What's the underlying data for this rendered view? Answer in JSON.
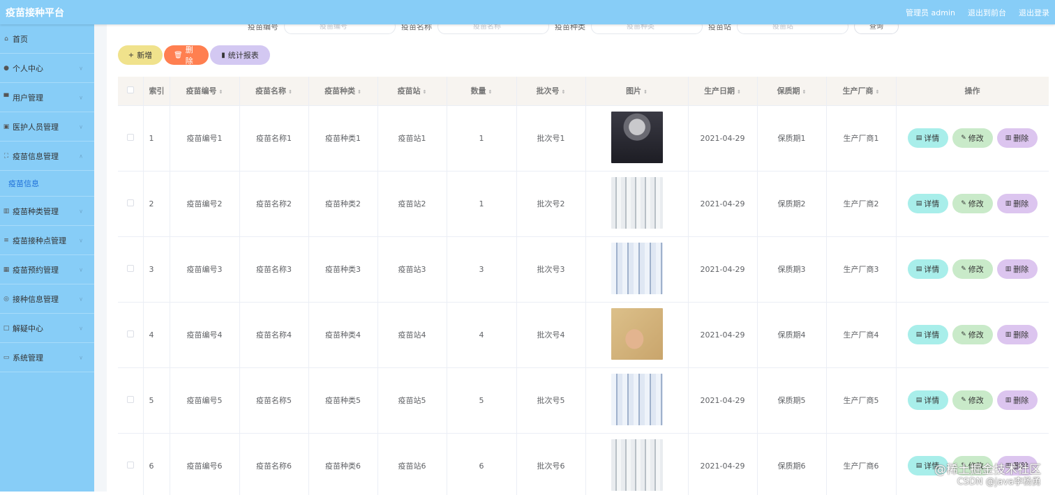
{
  "header": {
    "brand": "疫苗接种平台",
    "links": [
      "管理员 admin",
      "退出到前台",
      "退出登录"
    ]
  },
  "sidebar": {
    "items": [
      {
        "label": "首页",
        "icon": "home-icon",
        "chevron": false
      },
      {
        "label": "个人中心",
        "icon": "user-icon",
        "chevron": true
      },
      {
        "label": "用户管理",
        "icon": "users-icon",
        "chevron": true
      },
      {
        "label": "医护人员管理",
        "icon": "medical-icon",
        "chevron": true
      },
      {
        "label": "疫苗信息管理",
        "icon": "expand-icon",
        "chevron": true,
        "expanded": true
      }
    ],
    "submenu_label": "疫苗信息",
    "items2": [
      {
        "label": "疫苗种类管理",
        "icon": "bar-chart-icon"
      },
      {
        "label": "疫苗接种点管理",
        "icon": "list-icon"
      },
      {
        "label": "疫苗预约管理",
        "icon": "calendar-icon"
      },
      {
        "label": "接种信息管理",
        "icon": "globe-icon"
      },
      {
        "label": "解疑中心",
        "icon": "chat-icon"
      },
      {
        "label": "系统管理",
        "icon": "monitor-icon"
      }
    ]
  },
  "search": {
    "fields": [
      {
        "label": "疫苗编号",
        "placeholder": "疫苗编号"
      },
      {
        "label": "疫苗名称",
        "placeholder": "疫苗名称"
      },
      {
        "label": "疫苗种类",
        "placeholder": "疫苗种类"
      },
      {
        "label": "疫苗站",
        "placeholder": "疫苗站"
      }
    ],
    "query_label": "查询"
  },
  "toolbar": {
    "add_label": "新增",
    "delete_label": "删除",
    "report_label": "统计报表"
  },
  "table": {
    "columns": [
      "索引",
      "疫苗编号",
      "疫苗名称",
      "疫苗种类",
      "疫苗站",
      "数量",
      "批次号",
      "图片",
      "生产日期",
      "保质期",
      "生产厂商",
      "操作"
    ],
    "rows": [
      {
        "idx": "1",
        "code": "疫苗编号1",
        "name": "疫苗名称1",
        "type": "疫苗种类1",
        "station": "疫苗站1",
        "qty": "1",
        "batch": "批次号1",
        "img": "portrait",
        "date": "2021-04-29",
        "shelf": "保质期1",
        "maker": "生产厂商1"
      },
      {
        "idx": "2",
        "code": "疫苗编号2",
        "name": "疫苗名称2",
        "type": "疫苗种类2",
        "station": "疫苗站2",
        "qty": "1",
        "batch": "批次号2",
        "img": "vials",
        "date": "2021-04-29",
        "shelf": "保质期2",
        "maker": "生产厂商2"
      },
      {
        "idx": "3",
        "code": "疫苗编号3",
        "name": "疫苗名称3",
        "type": "疫苗种类3",
        "station": "疫苗站3",
        "qty": "3",
        "batch": "批次号3",
        "img": "vials-blue",
        "date": "2021-04-29",
        "shelf": "保质期3",
        "maker": "生产厂商3"
      },
      {
        "idx": "4",
        "code": "疫苗编号4",
        "name": "疫苗名称4",
        "type": "疫苗种类4",
        "station": "疫苗站4",
        "qty": "4",
        "batch": "批次号4",
        "img": "hand",
        "date": "2021-04-29",
        "shelf": "保质期4",
        "maker": "生产厂商4"
      },
      {
        "idx": "5",
        "code": "疫苗编号5",
        "name": "疫苗名称5",
        "type": "疫苗种类5",
        "station": "疫苗站5",
        "qty": "5",
        "batch": "批次号5",
        "img": "vials-blue",
        "date": "2021-04-29",
        "shelf": "保质期5",
        "maker": "生产厂商5"
      },
      {
        "idx": "6",
        "code": "疫苗编号6",
        "name": "疫苗名称6",
        "type": "疫苗种类6",
        "station": "疫苗站6",
        "qty": "6",
        "batch": "批次号6",
        "img": "vials",
        "date": "2021-04-29",
        "shelf": "保质期6",
        "maker": "生产厂商6"
      }
    ],
    "op_labels": {
      "detail": "详情",
      "edit": "修改",
      "delete": "删除"
    }
  },
  "watermark": {
    "line1": "@稀土掘金技术社区",
    "line2": "CSDN @java李杨勇"
  },
  "colors": {
    "accent": "#87cdf7",
    "add": "#f0e28c",
    "delete": "#ff7f50",
    "report": "#d3c8f2",
    "detail": "#a8eeea",
    "edit": "#c9eac9",
    "row_delete": "#dcc5ef"
  }
}
